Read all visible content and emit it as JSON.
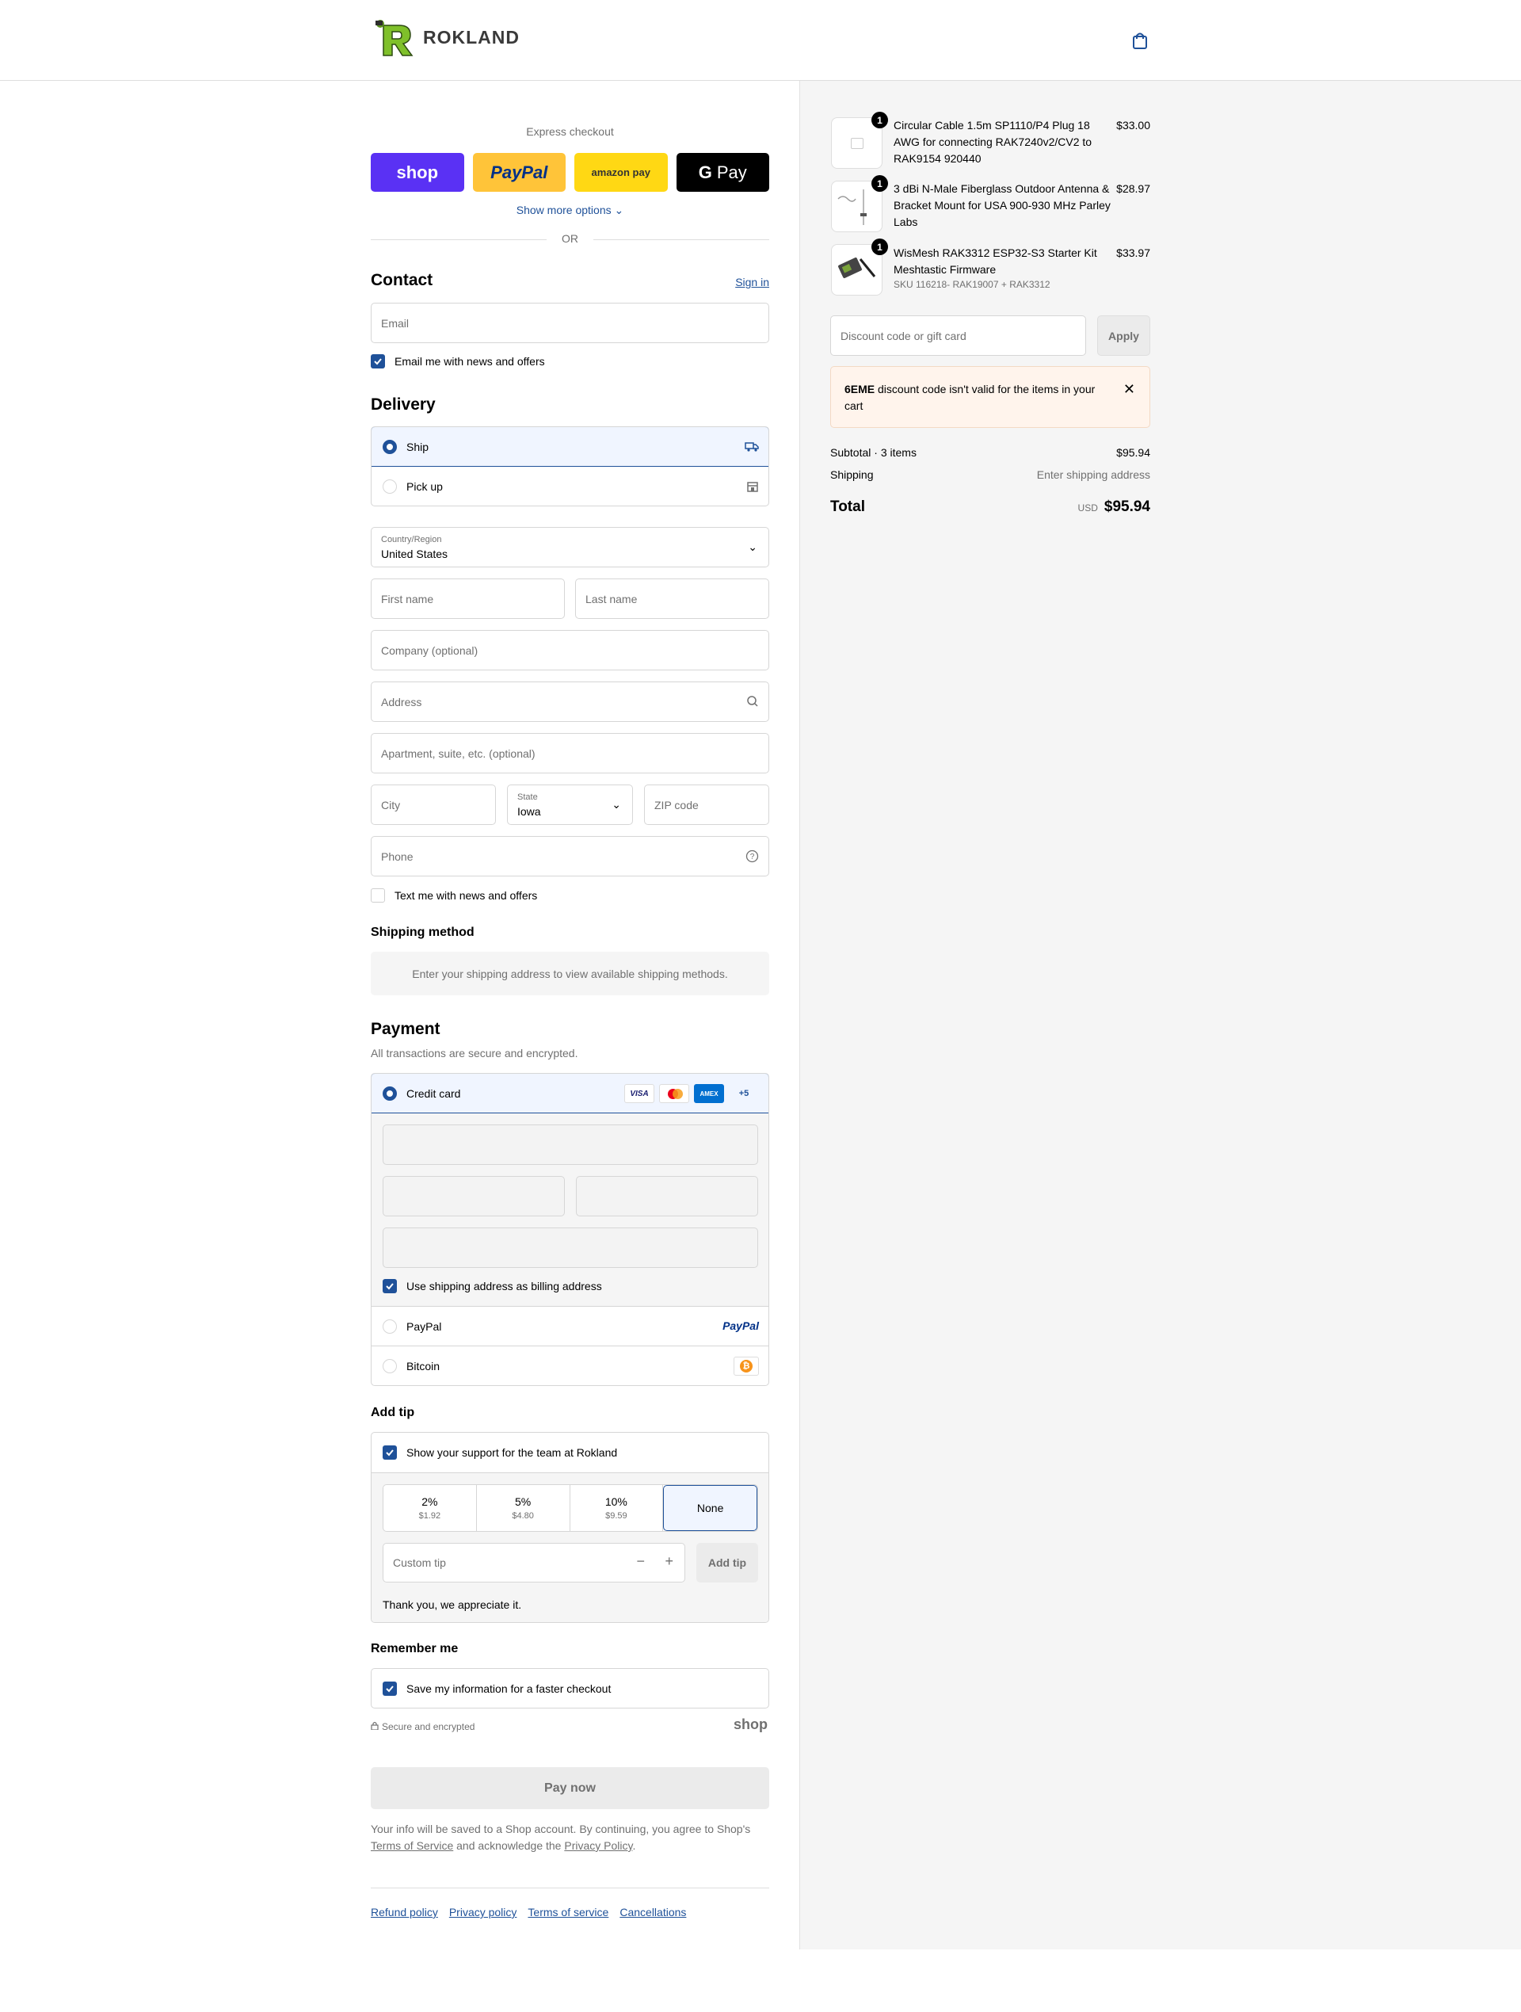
{
  "brand": {
    "name": "ROKLAND"
  },
  "express": {
    "title": "Express checkout",
    "shop_label": "shop",
    "paypal_label": "PayPal",
    "amazon_label": "amazon pay",
    "gpay_label": "Pay",
    "show_more": "Show more options",
    "or": "OR"
  },
  "contact": {
    "title": "Contact",
    "sign_in": "Sign in",
    "email_placeholder": "Email",
    "news_opt": "Email me with news and offers"
  },
  "delivery": {
    "title": "Delivery",
    "ship": "Ship",
    "pickup": "Pick up",
    "country_label": "Country/Region",
    "country_value": "United States",
    "first_name": "First name",
    "last_name": "Last name",
    "company": "Company (optional)",
    "address": "Address",
    "apartment": "Apartment, suite, etc. (optional)",
    "city": "City",
    "state_label": "State",
    "state_value": "Iowa",
    "zip": "ZIP code",
    "phone": "Phone",
    "text_opt": "Text me with news and offers"
  },
  "shipping_method": {
    "title": "Shipping method",
    "message": "Enter your shipping address to view available shipping methods."
  },
  "payment": {
    "title": "Payment",
    "subtitle": "All transactions are secure and encrypted.",
    "credit_card": "Credit card",
    "more_cards": "+5",
    "visa": "VISA",
    "amex": "AMEX",
    "billing_opt": "Use shipping address as billing address",
    "paypal": "PayPal",
    "paypal_logo": "PayPal",
    "bitcoin": "Bitcoin"
  },
  "tip": {
    "title": "Add tip",
    "support": "Show your support for the team at Rokland",
    "options": [
      {
        "pct": "2%",
        "amt": "$1.92"
      },
      {
        "pct": "5%",
        "amt": "$4.80"
      },
      {
        "pct": "10%",
        "amt": "$9.59"
      }
    ],
    "none": "None",
    "custom_placeholder": "Custom tip",
    "add_button": "Add tip",
    "thanks": "Thank you, we appreciate it."
  },
  "remember": {
    "title": "Remember me",
    "save": "Save my information for a faster checkout",
    "secure": "Secure and encrypted",
    "shop_logo": "shop"
  },
  "pay_now": "Pay now",
  "legal": {
    "line1": "Your info will be saved to a Shop account. By continuing, you agree to Shop's",
    "tos": "Terms of Service",
    "mid": " and acknowledge the ",
    "privacy": "Privacy Policy",
    "end": "."
  },
  "footer": {
    "refund": "Refund policy",
    "privacy": "Privacy policy",
    "terms": "Terms of service",
    "cancellations": "Cancellations"
  },
  "cart": {
    "items": [
      {
        "qty": "1",
        "name": "Circular Cable 1.5m SP1110/P4 Plug 18 AWG for connecting RAK7240v2/CV2 to RAK9154 920440",
        "price": "$33.00",
        "sku": ""
      },
      {
        "qty": "1",
        "name": "3 dBi N-Male Fiberglass Outdoor Antenna & Bracket Mount for USA 900-930 MHz Parley Labs",
        "price": "$28.97",
        "sku": ""
      },
      {
        "qty": "1",
        "name": "WisMesh RAK3312 ESP32-S3 Starter Kit Meshtastic Firmware",
        "price": "$33.97",
        "sku": "SKU 116218- RAK19007 + RAK3312"
      }
    ],
    "discount_placeholder": "Discount code or gift card",
    "apply": "Apply",
    "error_code": "6EME",
    "error_text": " discount code isn't valid for the items in your cart",
    "subtotal_label": "Subtotal · 3 items",
    "subtotal": "$95.94",
    "shipping_label": "Shipping",
    "shipping_value": "Enter shipping address",
    "total_label": "Total",
    "currency": "USD",
    "total": "$95.94"
  }
}
